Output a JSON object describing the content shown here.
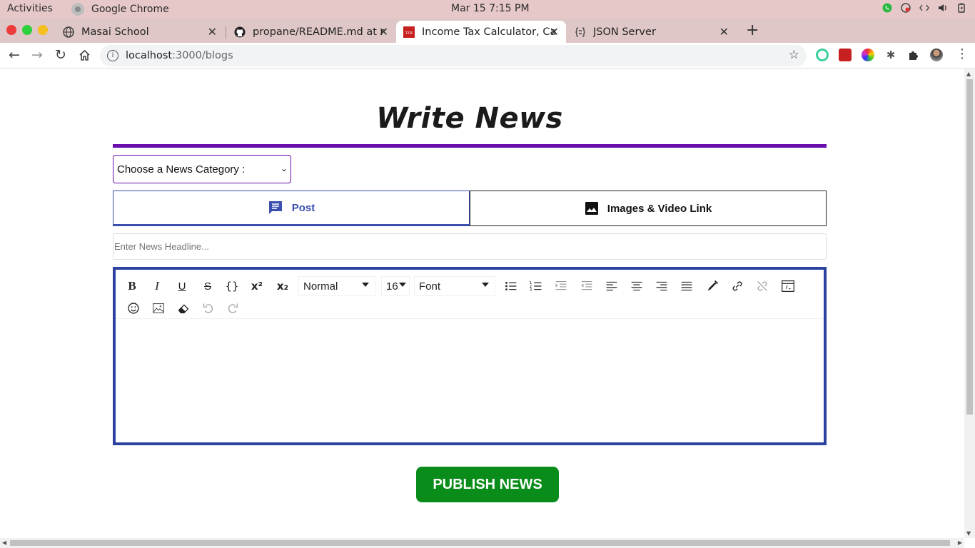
{
  "os": {
    "activities": "Activities",
    "app_name": "Google Chrome",
    "clock": "Mar 15   7:15 PM"
  },
  "tabs": [
    {
      "label": "Masai School",
      "icon": "globe-icon"
    },
    {
      "label": "propane/README.md at r",
      "icon": "github-icon"
    },
    {
      "label": "Income Tax Calculator, Ca",
      "icon": "toi-icon",
      "active": true
    },
    {
      "label": "JSON Server",
      "icon": "json-icon"
    }
  ],
  "address": {
    "host": "localhost",
    "path": ":3000/blogs"
  },
  "page": {
    "title": "Write News",
    "category_placeholder": "Choose a News Category :",
    "post_tab": "Post",
    "media_tab": "Images & Video Link",
    "headline_placeholder": "Enter News Headline...",
    "publish_label": "PUBLISH NEWS"
  },
  "editor": {
    "block_type": "Normal",
    "font_size": "16",
    "font_family": "Font"
  },
  "colors": {
    "accent_purple": "#6a0dad",
    "editor_blue": "#2c41a0",
    "publish_green": "#0a8c1a"
  }
}
